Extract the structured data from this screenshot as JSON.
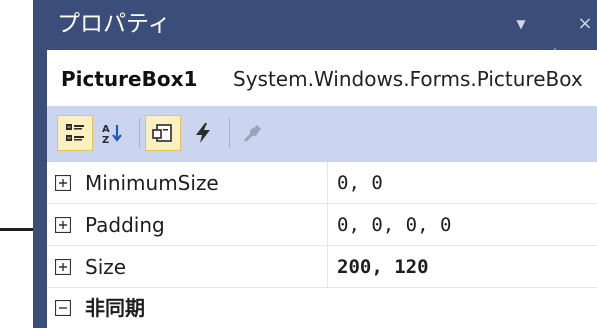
{
  "window": {
    "title": "プロパティ",
    "dropdown_icon": "chevron-down-icon",
    "pin_icon": "pin-icon",
    "close_icon": "close-icon"
  },
  "object_selector": {
    "name": "PictureBox1",
    "type": "System.Windows.Forms.PictureBox"
  },
  "toolbar": {
    "buttons": [
      {
        "icon": "categorized-icon",
        "active": true
      },
      {
        "icon": "alphabetical-icon",
        "active": false
      },
      {
        "icon": "properties-icon",
        "active": true
      },
      {
        "icon": "events-icon",
        "active": false
      },
      {
        "icon": "property-pages-icon",
        "active": false,
        "disabled": true
      }
    ]
  },
  "properties": {
    "rows": [
      {
        "name": "MinimumSize",
        "value": "0, 0",
        "expandable": true,
        "modified": false
      },
      {
        "name": "Padding",
        "value": "0, 0, 0, 0",
        "expandable": true,
        "modified": false
      },
      {
        "name": "Size",
        "value": "200, 120",
        "expandable": true,
        "modified": true
      }
    ],
    "category": {
      "name": "非同期",
      "expanded": true
    }
  },
  "colors": {
    "titlebar": "#3b4e7a",
    "toolbar": "#ccd5f0",
    "active_button": "#fdf0c0"
  }
}
